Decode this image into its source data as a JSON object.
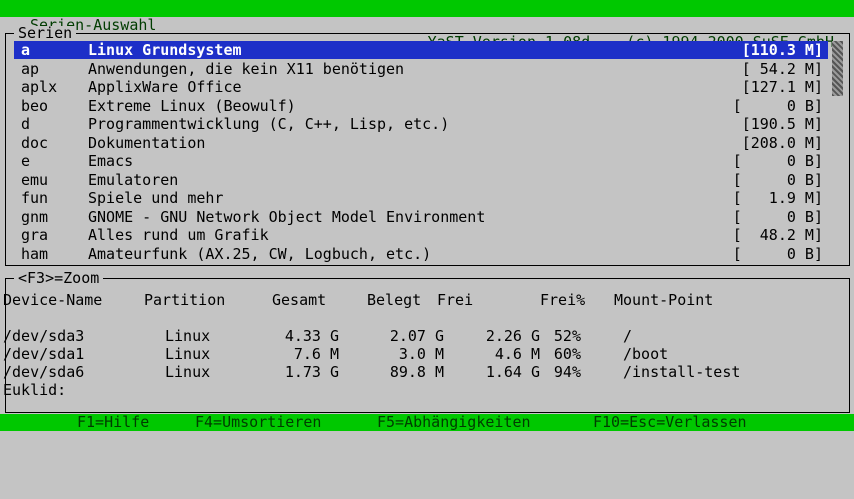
{
  "topbar": {
    "left": "Serien-Auswahl",
    "right": "YaST Version 1.08d -- (c) 1994-2000 SuSE GmbH"
  },
  "series_frame": {
    "title": "Serien"
  },
  "series": [
    {
      "code": "a",
      "name": "Linux Grundsystem",
      "size": "[110.3 M]",
      "selected": true
    },
    {
      "code": "ap",
      "name": "Anwendungen, die kein X11 benötigen",
      "size": "[ 54.2 M]"
    },
    {
      "code": "aplx",
      "name": "ApplixWare Office",
      "size": "[127.1 M]"
    },
    {
      "code": "beo",
      "name": "Extreme Linux (Beowulf)",
      "size": "[     0 B]"
    },
    {
      "code": "d",
      "name": "Programmentwicklung (C, C++, Lisp, etc.)",
      "size": "[190.5 M]"
    },
    {
      "code": "doc",
      "name": "Dokumentation",
      "size": "[208.0 M]"
    },
    {
      "code": "e",
      "name": "Emacs",
      "size": "[     0 B]"
    },
    {
      "code": "emu",
      "name": "Emulatoren",
      "size": "[     0 B]"
    },
    {
      "code": "fun",
      "name": "Spiele und mehr",
      "size": "[   1.9 M]"
    },
    {
      "code": "gnm",
      "name": "GNOME - GNU Network Object Model Environment",
      "size": "[     0 B]"
    },
    {
      "code": "gra",
      "name": "Alles rund um Grafik",
      "size": "[  48.2 M]"
    },
    {
      "code": "ham",
      "name": "Amateurfunk (AX.25, CW, Logbuch, etc.)",
      "size": "[     0 B]"
    }
  ],
  "zoom_frame": {
    "title": "<F3>=Zoom"
  },
  "device_headers": {
    "device": "Device-Name",
    "partition": "Partition",
    "total": "Gesamt",
    "used": "Belegt",
    "free": "Frei",
    "pct": "Frei%",
    "mount": "Mount-Point"
  },
  "devices": [
    {
      "device": "/dev/sda3",
      "partition": "Linux",
      "total": "4.33 G",
      "used": "2.07 G",
      "free": "2.26 G",
      "pct": "52%",
      "mount": "/"
    },
    {
      "device": "/dev/sda1",
      "partition": "Linux",
      "total": "7.6 M",
      "used": "3.0 M",
      "free": "4.6 M",
      "pct": "60%",
      "mount": "/boot"
    },
    {
      "device": "/dev/sda6",
      "partition": "Linux",
      "total": "1.73 G",
      "used": "89.8 M",
      "free": "1.64 G",
      "pct": "94%",
      "mount": "/install-test"
    }
  ],
  "euklid_label": "Euklid:",
  "bottombar": {
    "help": "F1=Hilfe",
    "sort": "F4=Umsortieren",
    "deps": "F5=Abhängigkeiten",
    "exit": "F10=Esc=Verlassen"
  },
  "colors": {
    "bar": "#00c800",
    "background": "#c4c4c4",
    "selection": "#1d2fc8"
  }
}
